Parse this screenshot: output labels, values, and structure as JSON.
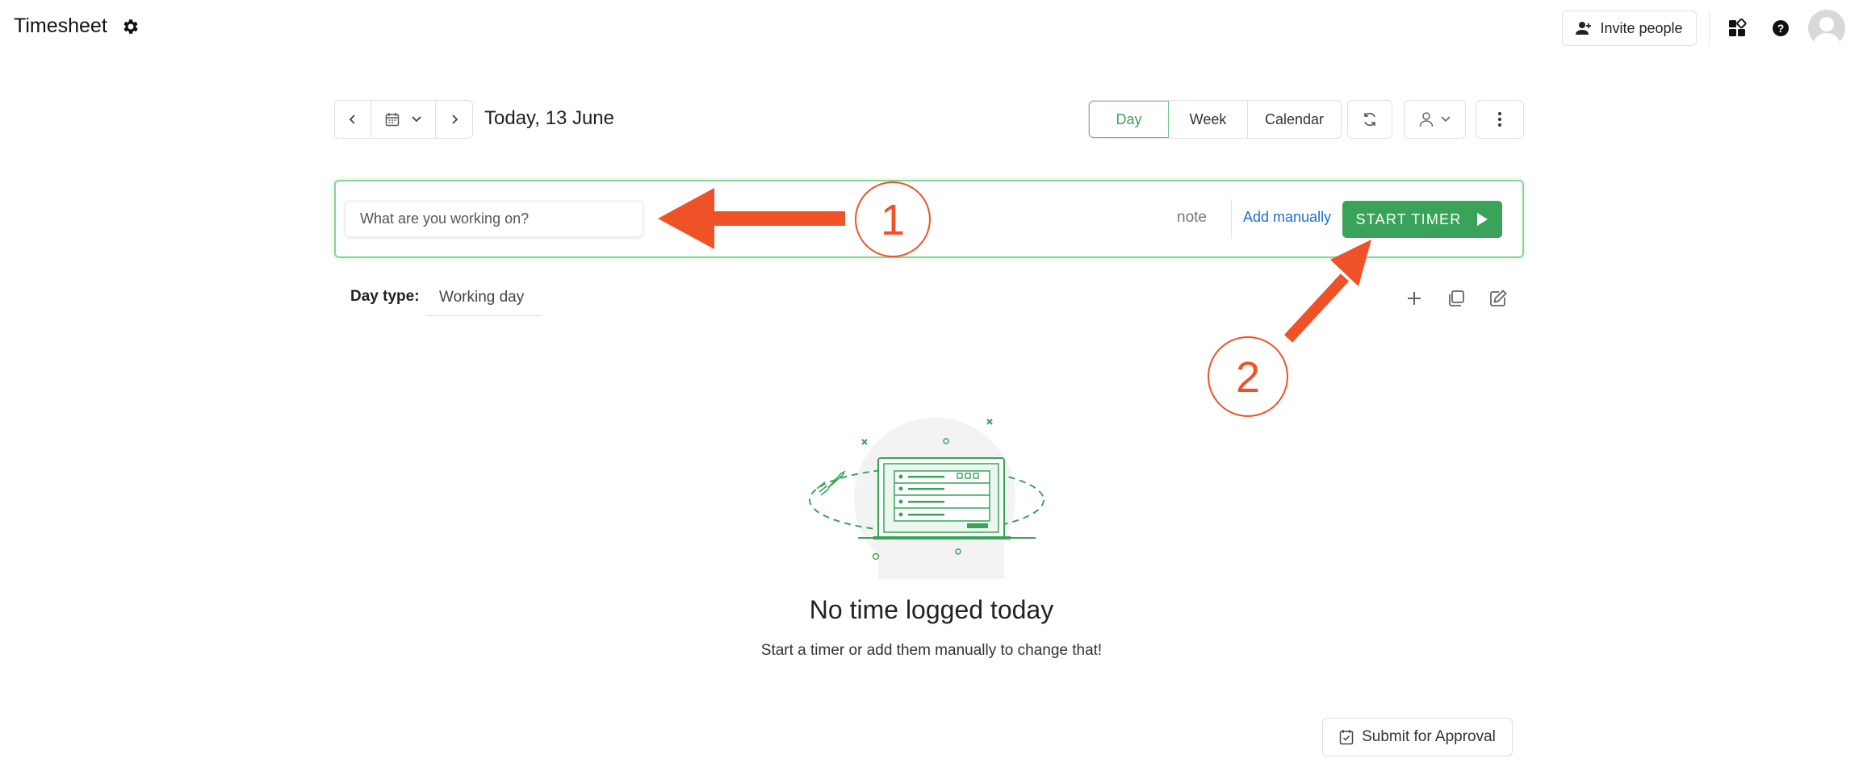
{
  "header": {
    "title": "Timesheet",
    "invite_label": "Invite people"
  },
  "date_nav": {
    "date_label": "Today, 13 June"
  },
  "view_tabs": [
    {
      "label": "Day",
      "active": true
    },
    {
      "label": "Week",
      "active": false
    },
    {
      "label": "Calendar",
      "active": false
    }
  ],
  "timer": {
    "placeholder": "What are you working on?",
    "note_label": "note",
    "add_manually_label": "Add manually",
    "start_label": "START TIMER"
  },
  "day_type": {
    "label": "Day type:",
    "value": "Working day"
  },
  "empty_state": {
    "title": "No time logged today",
    "subtitle": "Start a timer or add them manually to change that!"
  },
  "footer": {
    "submit_label": "Submit for Approval"
  },
  "annotations": {
    "step1": "1",
    "step2": "2"
  },
  "colors": {
    "brand_green": "#3aa35a",
    "border_green": "#83d497",
    "link_blue": "#1e6fd9",
    "annotation_orange": "#f05228"
  }
}
